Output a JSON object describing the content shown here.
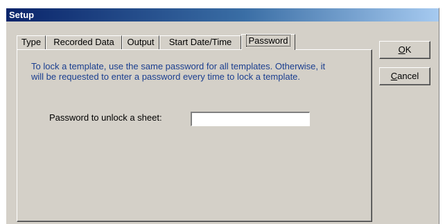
{
  "window": {
    "title": "Setup"
  },
  "tabs": [
    {
      "label": "Type"
    },
    {
      "label": "Recorded Data"
    },
    {
      "label": "Output"
    },
    {
      "label": "Start Date/Time"
    },
    {
      "label": "Password",
      "active": true
    }
  ],
  "password_tab": {
    "info_text": "To lock a template, use the same password for all templates. Otherwise, it will be requested to enter a password every time to lock a template.",
    "field_label": "Password to unlock a sheet:",
    "field_value": ""
  },
  "buttons": {
    "ok": {
      "accel": "O",
      "rest": "K"
    },
    "cancel": {
      "accel": "C",
      "rest": "ancel"
    }
  },
  "colors": {
    "info_text": "#1a3e8f",
    "face": "#d4d0c8",
    "title_start": "#0a246a"
  }
}
